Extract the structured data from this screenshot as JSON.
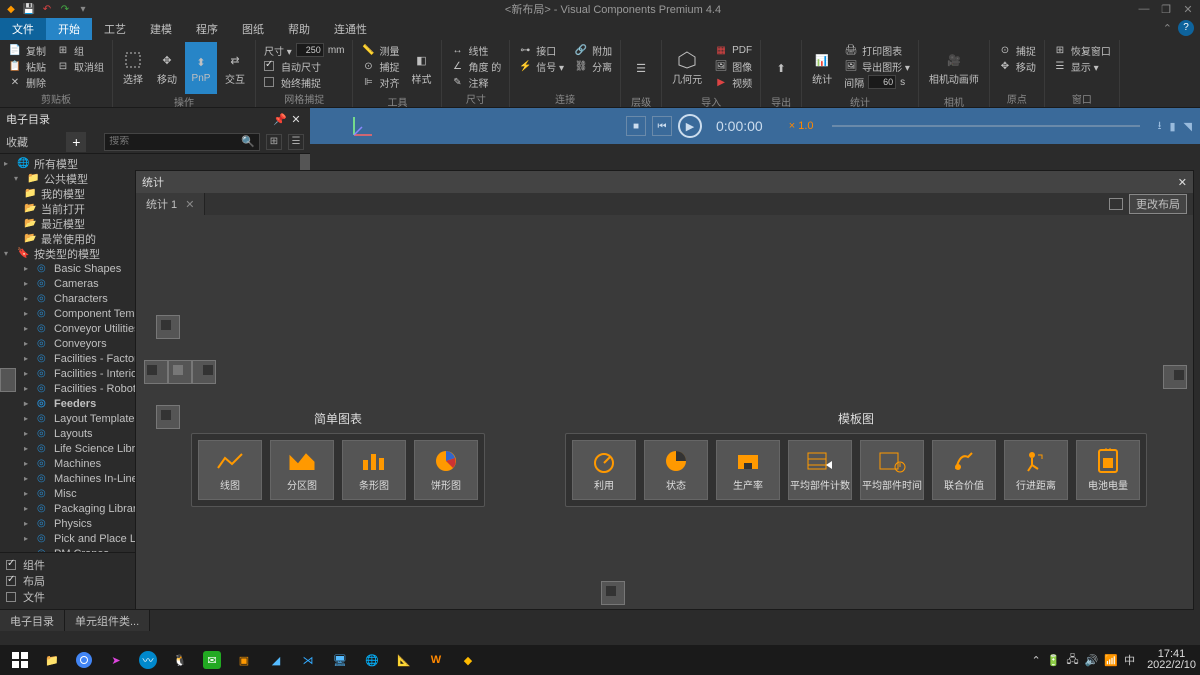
{
  "title": "<新布局> - Visual Components Premium 4.4",
  "menus": {
    "file": "文件",
    "start": "开始",
    "craft": "工艺",
    "model": "建模",
    "program": "程序",
    "drawing": "图纸",
    "help": "帮助",
    "connect": "连通性"
  },
  "ribbon": {
    "clipboard": {
      "label": "剪贴板",
      "copy": "复制",
      "paste": "粘贴",
      "delete": "删除",
      "group": "组"
    },
    "operate": {
      "label": "操作",
      "select": "选择",
      "move": "移动",
      "pnp": "PnP",
      "interact": "交互"
    },
    "grid": {
      "label": "网格捕捉",
      "auto": "自动尺寸",
      "always": "始终捕捉",
      "size_val": "250",
      "size_unit": "mm",
      "size_label": "尺寸 ▾"
    },
    "tools": {
      "label": "工具",
      "measure": "测量",
      "capture": "捕捉",
      "align": "对齐",
      "style": "样式"
    },
    "dimension": {
      "label": "尺寸",
      "linear": "线性",
      "angle": "角度 的",
      "annot": "注释"
    },
    "connect": {
      "label": "连接",
      "iface": "接口",
      "signal": "信号 ▾",
      "attach": "附加",
      "detach": "分离"
    },
    "layer": {
      "label": "层级"
    },
    "import": {
      "label": "导入",
      "geom": "几何元",
      "image": "图像",
      "video": "视频",
      "pdf": "PDF"
    },
    "export": {
      "label": "导出"
    },
    "stats": {
      "label": "统计",
      "stats": "统计",
      "print": "打印图表",
      "expimg": "导出图形 ▾",
      "interval": "间隔",
      "interval_val": "60",
      "interval_unit": "s"
    },
    "camera": {
      "label": "相机",
      "anim": "相机动画师"
    },
    "origin": {
      "label": "原点",
      "capture": "捕捉",
      "move": "移动"
    },
    "window": {
      "label": "窗口",
      "restore": "恢复窗口",
      "show": "显示 ▾"
    }
  },
  "ecatalog": {
    "title": "电子目录",
    "fav": "收藏",
    "search_placeholder": "搜索",
    "tree": {
      "all": "所有模型",
      "public": "公共模型",
      "mine": "我的模型",
      "current": "当前打开",
      "recent": "最近模型",
      "frequent": "最常使用的",
      "bytype": "按类型的模型",
      "cats": [
        "Basic Shapes",
        "Cameras",
        "Characters",
        "Component Templ",
        "Conveyor Utilities",
        "Conveyors",
        "Facilities - Factory",
        "Facilities - Interior",
        "Facilities - Robot",
        "Feeders",
        "Layout Templates",
        "Layouts",
        "Life Science Libra",
        "Machines",
        "Machines In-Line",
        "Misc",
        "Packaging Library",
        "Physics",
        "Pick and Place Lib",
        "PM Cranes"
      ]
    },
    "checks": {
      "component": "组件",
      "layout": "布局",
      "file": "文件"
    },
    "bottom_tabs": {
      "ecatalog": "电子目录",
      "unit": "单元组件类..."
    }
  },
  "timeline": {
    "time": "0:00:00",
    "speed": "× 1.0"
  },
  "stats": {
    "title": "统计",
    "tab": "统计 1",
    "change_layout": "更改布局",
    "simple": "简单图表",
    "templates": "模板图",
    "simple_cards": [
      "线图",
      "分区图",
      "条形图",
      "饼形图"
    ],
    "template_cards": [
      "利用",
      "状态",
      "生产率",
      "平均部件计数",
      "平均部件时间",
      "联合价值",
      "行进距离",
      "电池电量"
    ]
  },
  "taskbar": {
    "time": "17:41",
    "date": "2022/2/10",
    "ime": "中"
  }
}
